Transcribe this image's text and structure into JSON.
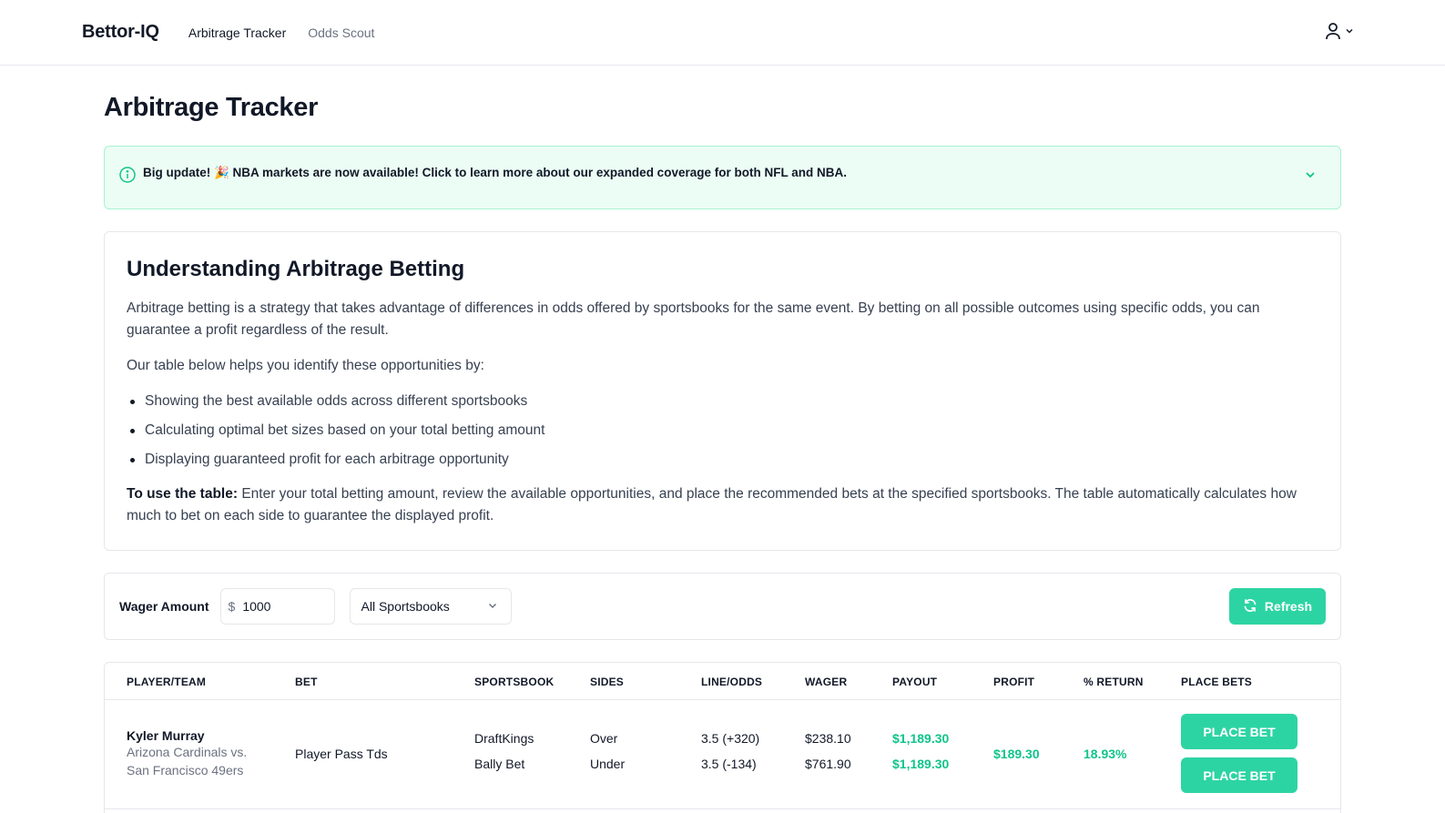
{
  "nav": {
    "brand": "Bettor-IQ",
    "links": [
      {
        "label": "Arbitrage Tracker",
        "active": true
      },
      {
        "label": "Odds Scout",
        "active": false
      }
    ],
    "user_icon": "user-icon"
  },
  "page": {
    "title": "Arbitrage Tracker"
  },
  "banner": {
    "text": "Big update! 🎉 NBA markets are now available! Click to learn more about our expanded coverage for both NFL and NBA.",
    "icon": "info-icon"
  },
  "info": {
    "title": "Understanding Arbitrage Betting",
    "p1": "Arbitrage betting is a strategy that takes advantage of differences in odds offered by sportsbooks for the same event. By betting on all possible outcomes using specific odds, you can guarantee a profit regardless of the result.",
    "p2": "Our table below helps you identify these opportunities by:",
    "bullets": [
      "Showing the best available odds across different sportsbooks",
      "Calculating optimal bet sizes based on your total betting amount",
      "Displaying guaranteed profit for each arbitrage opportunity"
    ],
    "p3_strong": "To use the table:",
    "p3_rest": " Enter your total betting amount, review the available opportunities, and place the recommended bets at the specified sportsbooks. The table automatically calculates how much to bet on each side to guarantee the displayed profit."
  },
  "controls": {
    "wager_label": "Wager Amount",
    "currency": "$",
    "wager_value": "1000",
    "sportsbook_select": "All Sportsbooks",
    "refresh_label": "Refresh"
  },
  "table": {
    "headers": [
      "PLAYER/TEAM",
      "BET",
      "SPORTSBOOK",
      "SIDES",
      "LINE/ODDS",
      "WAGER",
      "PAYOUT",
      "PROFIT",
      "% RETURN",
      "PLACE BETS"
    ],
    "rows": [
      {
        "player": "Kyler Murray",
        "matchup_line1": "Arizona Cardinals vs.",
        "matchup_line2": "San Francisco 49ers",
        "bet": "Player Pass Tds",
        "legs": [
          {
            "sportsbook": "DraftKings",
            "side": "Over",
            "line": "3.5 (+320)",
            "wager": "$238.10",
            "payout": "$1,189.30",
            "button": "PLACE BET"
          },
          {
            "sportsbook": "Bally Bet",
            "side": "Under",
            "line": "3.5 (-134)",
            "wager": "$761.90",
            "payout": "$1,189.30",
            "button": "PLACE BET"
          }
        ],
        "profit": "$189.30",
        "return": "18.93%"
      }
    ]
  },
  "colors": {
    "accent": "#2dd4a3",
    "accent_text": "#10c48a",
    "banner_bg": "#ecfdf5",
    "banner_border": "#a7f3d0"
  }
}
